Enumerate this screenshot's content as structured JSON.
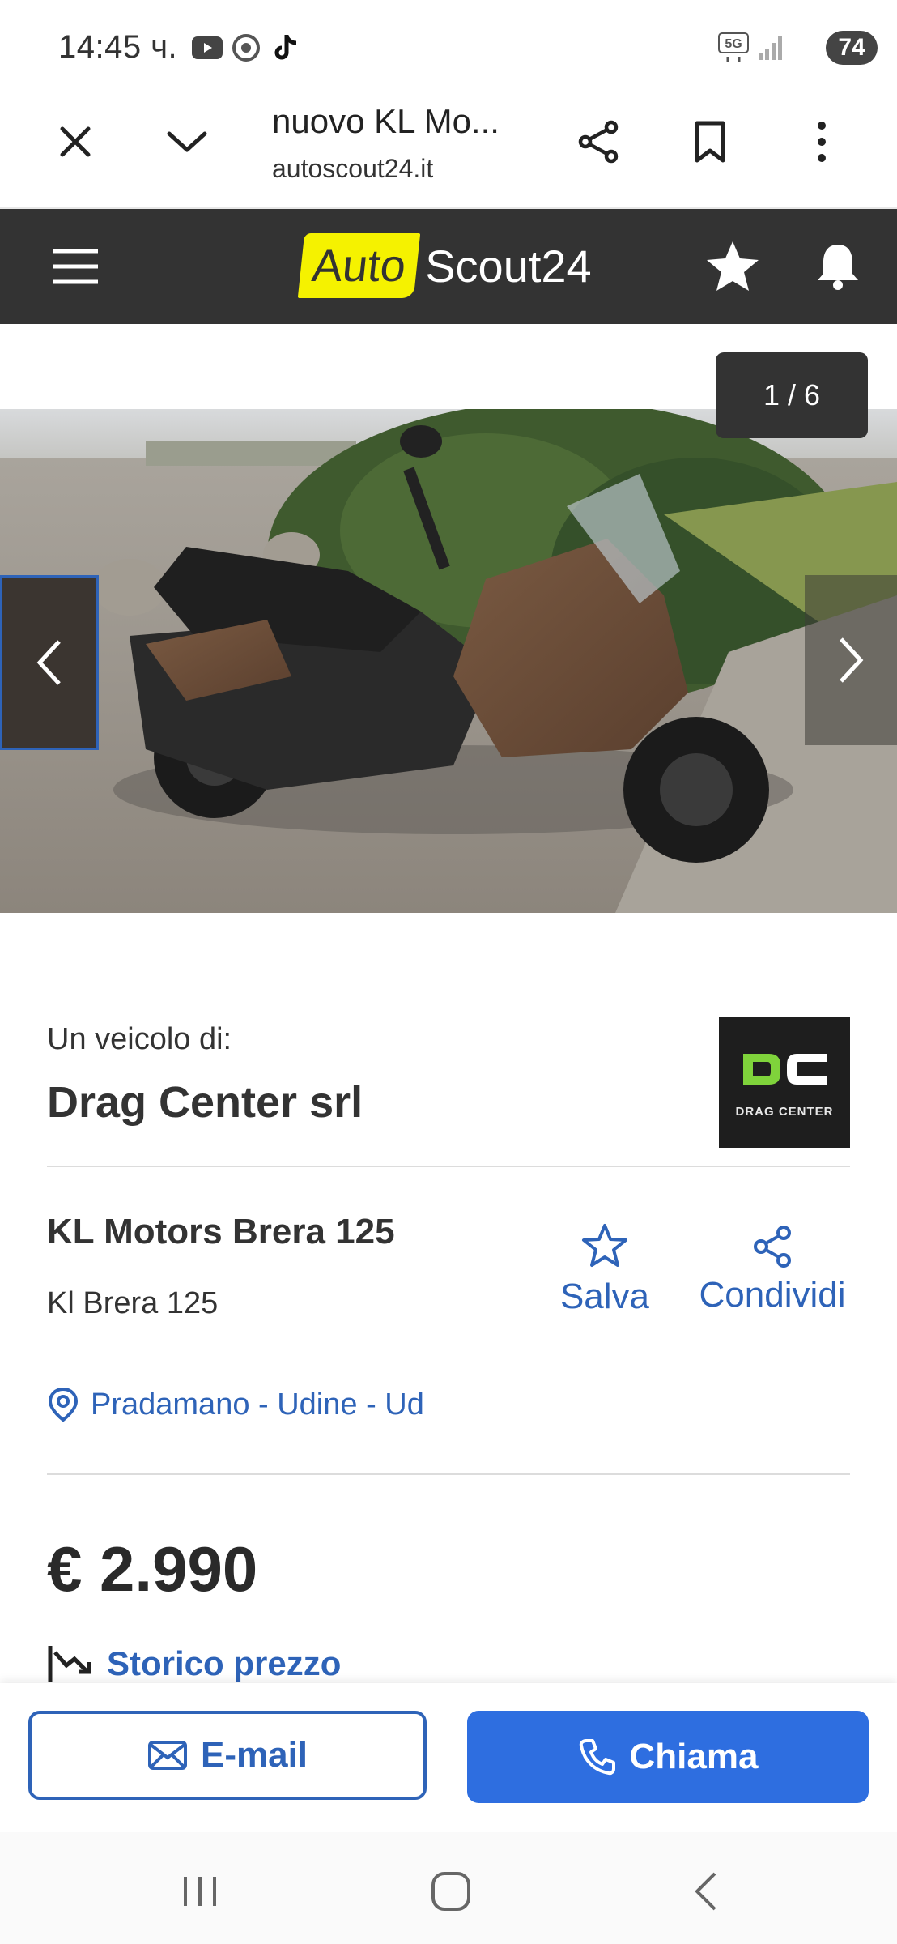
{
  "status": {
    "time": "14:45 ч.",
    "battery": "74",
    "network": "5G"
  },
  "browser": {
    "page_title": "nuovo KL Mo...",
    "url": "autoscout24.it"
  },
  "site": {
    "logo_auto": "Auto",
    "logo_scout": "Scout24"
  },
  "gallery": {
    "counter": "1 / 6"
  },
  "seller": {
    "label": "Un veicolo di:",
    "name": "Drag Center srl",
    "logo_text": "DRAG CENTER"
  },
  "listing": {
    "title": "KL Motors Brera 125",
    "subtitle": "Kl Brera 125",
    "save_label": "Salva",
    "share_label": "Condividi",
    "location": "Pradamano - Udine - Ud",
    "price": "€ 2.990",
    "price_history_label": "Storico prezzo"
  },
  "actions": {
    "email_label": "E-mail",
    "call_label": "Chiama"
  },
  "colors": {
    "brand_yellow": "#f5f200",
    "header_dark": "#333333",
    "link_blue": "#2e63b8",
    "call_blue": "#2e6ee0",
    "dc_green": "#7fd33b"
  },
  "icons": [
    "youtube-icon",
    "chrome-icon",
    "tiktok-icon",
    "signal-icon",
    "close-icon",
    "chevron-down-icon",
    "share-icon",
    "bookmark-icon",
    "more-vert-icon",
    "menu-icon",
    "star-icon",
    "bell-icon",
    "chevron-left-icon",
    "chevron-right-icon",
    "location-pin-icon",
    "price-history-icon",
    "mail-icon",
    "phone-icon",
    "recent-apps-icon",
    "home-icon",
    "back-icon"
  ]
}
